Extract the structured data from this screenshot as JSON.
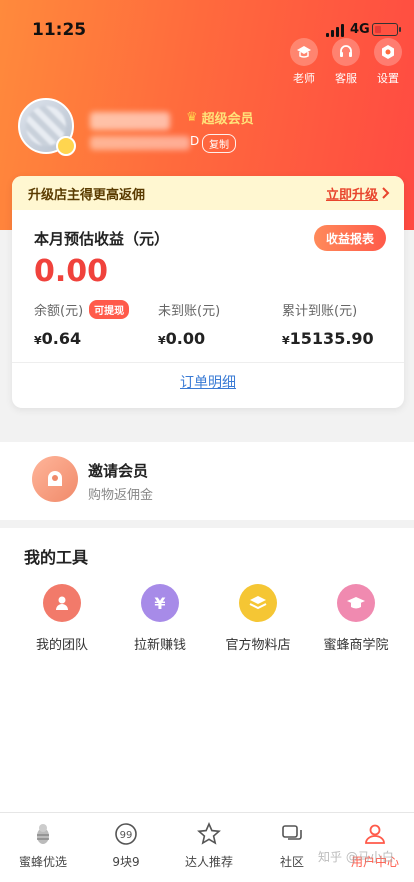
{
  "status": {
    "time": "11:25",
    "network": "4G"
  },
  "header": {
    "icons": [
      {
        "label": "老师",
        "icon": "graduation-cap-icon"
      },
      {
        "label": "客服",
        "icon": "headset-icon"
      },
      {
        "label": "设置",
        "icon": "gear-icon"
      }
    ],
    "member_label": "超级会员",
    "id_suffix": "D",
    "copy_label": "复制"
  },
  "upgrade": {
    "text": "升级店主得更高返佣",
    "action": "立即升级"
  },
  "earnings": {
    "title": "本月预估收益（元）",
    "report_label": "收益报表",
    "amount": "0.00",
    "stats": [
      {
        "caption": "余额(元)",
        "badge": "可提现",
        "value": "0.64"
      },
      {
        "caption": "未到账(元)",
        "value": "0.00"
      },
      {
        "caption": "累计到账(元)",
        "value": "15135.90"
      }
    ],
    "currency": "¥",
    "order_link": "订单明细"
  },
  "invite": {
    "title": "邀请会员",
    "subtitle": "购物返佣金"
  },
  "tools": {
    "heading": "我的工具",
    "items": [
      {
        "label": "我的团队",
        "color": "#f27a6a"
      },
      {
        "label": "拉新赚钱",
        "color": "#a78be8"
      },
      {
        "label": "官方物料店",
        "color": "#f5c634"
      },
      {
        "label": "蜜蜂商学院",
        "color": "#f08ab0"
      }
    ]
  },
  "tabbar": {
    "items": [
      {
        "label": "蜜蜂优选"
      },
      {
        "label": "9块9"
      },
      {
        "label": "达人推荐"
      },
      {
        "label": "社区"
      },
      {
        "label": "用户中心"
      }
    ]
  },
  "watermark": "知乎 @马小白"
}
